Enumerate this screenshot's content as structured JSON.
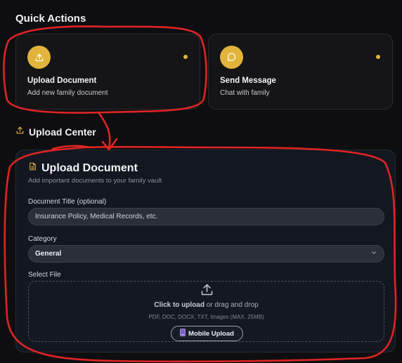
{
  "quick_actions": {
    "title": "Quick Actions",
    "cards": [
      {
        "title": "Upload Document",
        "subtitle": "Add new family document",
        "icon": "upload-icon"
      },
      {
        "title": "Send Message",
        "subtitle": "Chat with family",
        "icon": "message-bubble-icon"
      }
    ]
  },
  "upload_center": {
    "title": "Upload Center",
    "icon": "upload-icon"
  },
  "upload_panel": {
    "title": "Upload Document",
    "subtitle": "Add important documents to your family vault",
    "document_title_label": "Document Title (optional)",
    "document_title_placeholder": "Insurance Policy, Medical Records, etc.",
    "document_title_value": "",
    "category_label": "Category",
    "category_value": "General",
    "file_label": "Select File",
    "dropzone": {
      "click_text": "Click to upload",
      "rest_text": " or drag and drop",
      "formats": "PDF, DOC, DOCX, TXT, Images (MAX. 25MB)",
      "mobile_button": "Mobile Upload"
    }
  },
  "colors": {
    "accent": "#e2b43b",
    "annotation": "#e02424",
    "background": "#0e0e10"
  }
}
